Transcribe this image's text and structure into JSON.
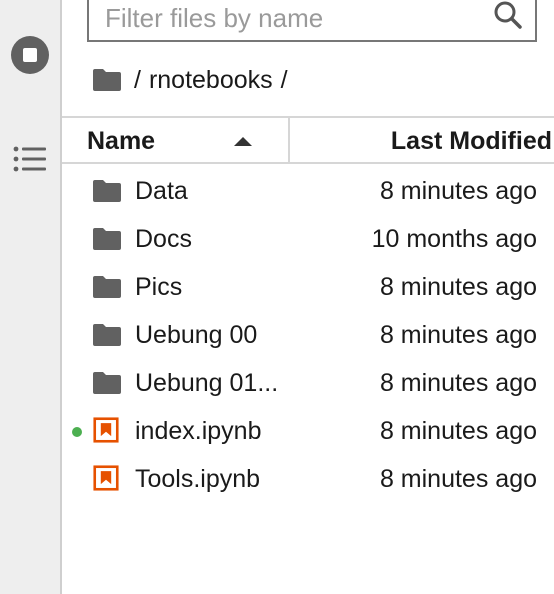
{
  "search": {
    "placeholder": "Filter files by name"
  },
  "breadcrumb": {
    "root": "/",
    "folder": "rnotebooks",
    "trailing": "/"
  },
  "columns": {
    "name": "Name",
    "last_modified": "Last Modified",
    "sort": "ascending"
  },
  "files": [
    {
      "name": "Data",
      "type": "folder",
      "modified": "8 minutes ago",
      "running": false
    },
    {
      "name": "Docs",
      "type": "folder",
      "modified": "10 months ago",
      "running": false
    },
    {
      "name": "Pics",
      "type": "folder",
      "modified": "8 minutes ago",
      "running": false
    },
    {
      "name": "Uebung 00",
      "type": "folder",
      "modified": "8 minutes ago",
      "running": false
    },
    {
      "name": "Uebung 01...",
      "type": "folder",
      "modified": "8 minutes ago",
      "running": false
    },
    {
      "name": "index.ipynb",
      "type": "notebook",
      "modified": "8 minutes ago",
      "running": true
    },
    {
      "name": "Tools.ipynb",
      "type": "notebook",
      "modified": "8 minutes ago",
      "running": false
    }
  ],
  "icons": {
    "sidebar": [
      "running-sessions-icon",
      "table-of-contents-icon"
    ],
    "folder": "folder-icon",
    "notebook": "notebook-icon",
    "search": "search-icon"
  },
  "colors": {
    "folder": "#616161",
    "notebook": "#e65100",
    "running_dot": "#4caf50"
  }
}
